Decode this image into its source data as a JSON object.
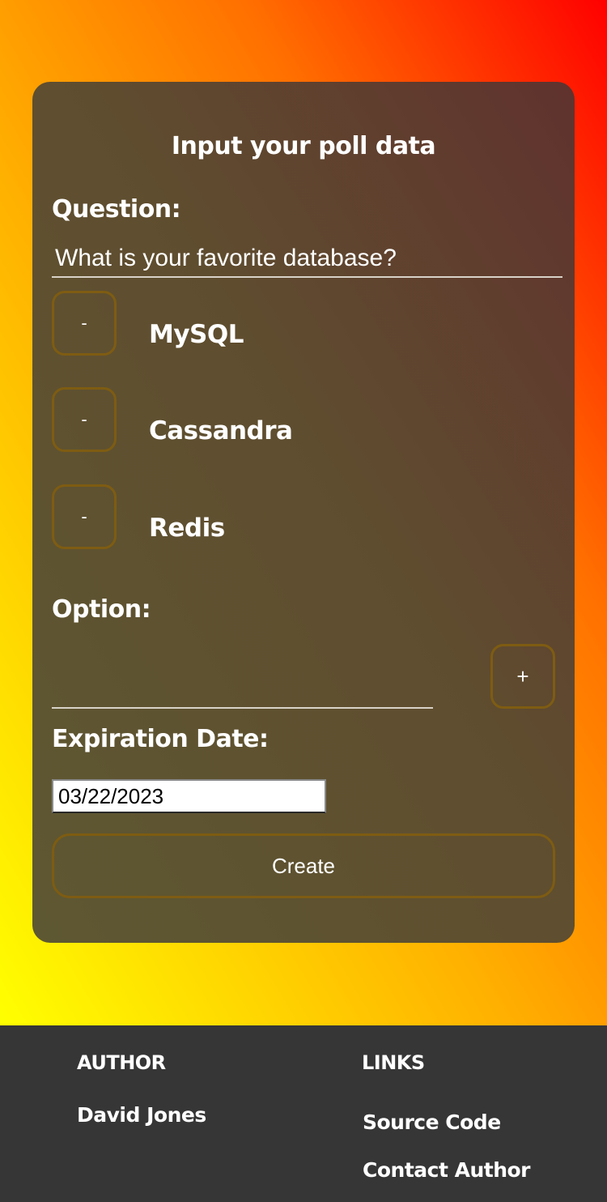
{
  "form": {
    "title": "Input your poll data",
    "question_label": "Question:",
    "question_value": "What is your favorite database?",
    "options": [
      {
        "remove_label": "-",
        "text": "MySQL"
      },
      {
        "remove_label": "-",
        "text": "Cassandra"
      },
      {
        "remove_label": "-",
        "text": "Redis"
      }
    ],
    "option_label": "Option:",
    "option_value": "",
    "add_label": "+",
    "expiration_label": "Expiration Date:",
    "expiration_value": "03/22/2023",
    "create_label": "Create"
  },
  "footer": {
    "author_heading": "AUTHOR",
    "author_name": "David Jones",
    "links_heading": "LINKS",
    "links": [
      "Source Code",
      "Contact Author"
    ]
  },
  "colors": {
    "gradient": [
      "#ffff00",
      "#ffb000",
      "#ff7000",
      "#ff0000"
    ],
    "card": "#5f4d2f",
    "button_border": "#7e5c12",
    "footer": "#363636"
  }
}
